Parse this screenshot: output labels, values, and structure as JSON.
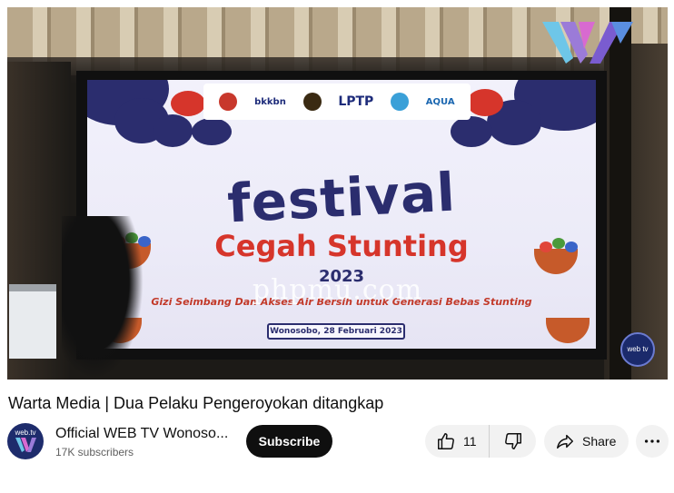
{
  "video": {
    "screen": {
      "logos": [
        "bkkbn",
        "LPTP",
        "AQUA"
      ],
      "heading": "festival",
      "subheading": "Cegah Stunting",
      "year": "2023",
      "tagline": "Gizi Seimbang Dan Akses Air Bersih untuk Generasi Bebas Stunting",
      "date": "Wonosobo, 28 Februari 2023"
    },
    "watermark": "phpmu.com",
    "round_logo_text": "web tv"
  },
  "title": "Warta Media | Dua Pelaku Pengeroyokan ditangkap",
  "channel": {
    "avatar_text": "web.tv",
    "name": "Official WEB TV Wonoso...",
    "subscribers": "17K subscribers",
    "subscribe_label": "Subscribe"
  },
  "actions": {
    "like_count": "11",
    "share_label": "Share"
  },
  "icons": {
    "like": "thumbs-up-icon",
    "dislike": "thumbs-down-icon",
    "share": "share-arrow-icon",
    "more": "more-dots-icon"
  },
  "colors": {
    "subscribe_bg": "#0f0f0f",
    "pill_bg": "#f2f2f2",
    "banner_navy": "#2b2d6e",
    "banner_red": "#d6352b"
  }
}
